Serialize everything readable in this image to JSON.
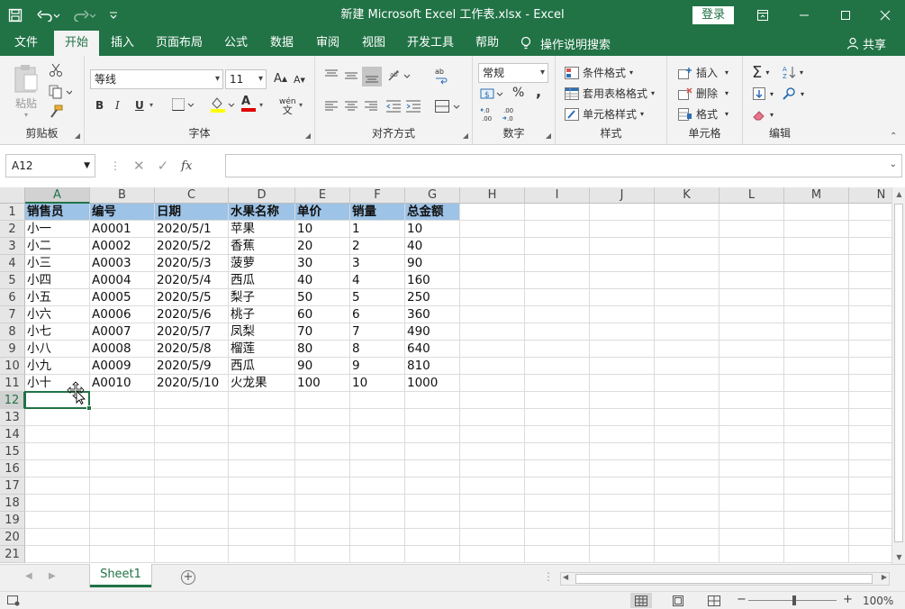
{
  "app": {
    "title": "新建 Microsoft Excel 工作表.xlsx  -  Excel",
    "login_label": "登录"
  },
  "ribbon_tabs": [
    "文件",
    "开始",
    "插入",
    "页面布局",
    "公式",
    "数据",
    "审阅",
    "视图",
    "开发工具",
    "帮助"
  ],
  "active_tab": "开始",
  "tell_me": "操作说明搜索",
  "share_label": "共享",
  "ribbon": {
    "clipboard": {
      "paste_label": "粘贴",
      "group_label": "剪贴板"
    },
    "font": {
      "font_name": "等线",
      "font_size": "11",
      "group_label": "字体",
      "bold": "B",
      "italic": "I",
      "underline": "U",
      "grow": "A",
      "shrink": "A",
      "font_color_glyph": "A",
      "phonetic": "wén"
    },
    "alignment": {
      "group_label": "对齐方式"
    },
    "number": {
      "format": "常规",
      "percent": "%",
      "comma": ",",
      "inc_decimal": "←.0\n.00",
      "dec_decimal": ".00\n→.0",
      "group_label": "数字"
    },
    "styles": {
      "conditional": "条件格式",
      "table_format": "套用表格格式",
      "cell_styles": "单元格样式",
      "group_label": "样式"
    },
    "cells": {
      "insert": "插入",
      "delete": "删除",
      "format": "格式",
      "group_label": "单元格"
    },
    "editing": {
      "group_label": "编辑"
    }
  },
  "formula_bar": {
    "name_box": "A12",
    "formula": ""
  },
  "columns": [
    "A",
    "B",
    "C",
    "D",
    "E",
    "F",
    "G",
    "H",
    "I",
    "J",
    "K",
    "L",
    "M",
    "N"
  ],
  "rows": [
    1,
    2,
    3,
    4,
    5,
    6,
    7,
    8,
    9,
    10,
    11,
    12,
    13,
    14,
    15,
    16,
    17,
    18,
    19,
    20,
    21
  ],
  "table": {
    "headers": [
      "销售员",
      "编号",
      "日期",
      "水果名称",
      "单价",
      "销量",
      "总金额"
    ],
    "rows": [
      [
        "小一",
        "A0001",
        "2020/5/1",
        "苹果",
        "10",
        "1",
        "10"
      ],
      [
        "小二",
        "A0002",
        "2020/5/2",
        "香蕉",
        "20",
        "2",
        "40"
      ],
      [
        "小三",
        "A0003",
        "2020/5/3",
        "菠萝",
        "30",
        "3",
        "90"
      ],
      [
        "小四",
        "A0004",
        "2020/5/4",
        "西瓜",
        "40",
        "4",
        "160"
      ],
      [
        "小五",
        "A0005",
        "2020/5/5",
        "梨子",
        "50",
        "5",
        "250"
      ],
      [
        "小六",
        "A0006",
        "2020/5/6",
        "桃子",
        "60",
        "6",
        "360"
      ],
      [
        "小七",
        "A0007",
        "2020/5/7",
        "凤梨",
        "70",
        "7",
        "490"
      ],
      [
        "小八",
        "A0008",
        "2020/5/8",
        "榴莲",
        "80",
        "8",
        "640"
      ],
      [
        "小九",
        "A0009",
        "2020/5/9",
        "西瓜",
        "90",
        "9",
        "810"
      ],
      [
        "小十",
        "A0010",
        "2020/5/10",
        "火龙果",
        "100",
        "10",
        "1000"
      ]
    ]
  },
  "sheets": [
    "Sheet1"
  ],
  "status": {
    "zoom": "100%",
    "zoom_minus": "−",
    "zoom_plus": "+"
  },
  "colors": {
    "excel_green": "#217346",
    "header_fill": "#9dc3e6"
  }
}
